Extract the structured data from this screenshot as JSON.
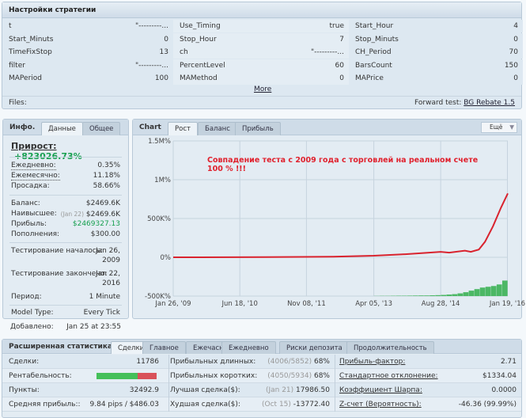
{
  "settings": {
    "title": "Настройки стратегии",
    "params": [
      [
        "t",
        "\"---------...",
        "Use_Timing",
        "true",
        "Start_Hour",
        "4"
      ],
      [
        "Start_Minuts",
        "0",
        "Stop_Hour",
        "7",
        "Stop_Minuts",
        "0"
      ],
      [
        "TimeFixStop",
        "13",
        "ch",
        "\"---------...",
        "CH_Period",
        "70"
      ],
      [
        "filter",
        "\"---------...",
        "PercentLevel",
        "60",
        "BarsCount",
        "150"
      ],
      [
        "MAPeriod",
        "100",
        "MAMethod",
        "0",
        "MAPrice",
        "0"
      ]
    ],
    "more": "More",
    "files": "Files:",
    "forward_label": "Forward test:",
    "forward_link": "BG Rebate 1.5"
  },
  "info": {
    "title": "Инфо.",
    "tabs": [
      "Данные",
      "Общее"
    ],
    "gain_label": "Прирост:",
    "gain": "+823026.73%",
    "rows1": [
      [
        "Ежедневно:",
        "0.35%"
      ],
      [
        "Ежемесячно:",
        "11.18%"
      ],
      [
        "Просадка:",
        "58.66%"
      ]
    ],
    "balance": [
      "Баланс:",
      "$2469.6K"
    ],
    "highest": [
      "Наивысшее:",
      "(Jan 22)",
      "$2469.6K"
    ],
    "profit": [
      "Прибыль:",
      "$2469327.13"
    ],
    "deposits": [
      "Пополнения:",
      "$300.00"
    ],
    "test_start": [
      "Тестирование началось:",
      "Jan 26,",
      "2009"
    ],
    "test_end": [
      "Тестирование закончено:",
      "Jan 22,",
      "2016"
    ],
    "period": [
      "Период:",
      "1 Minute"
    ],
    "model": [
      "Model Type:",
      "Every Tick"
    ],
    "added": [
      "Добавлено:",
      "Jan 25 at 23:55"
    ]
  },
  "chart_header": {
    "title": "Chart",
    "tabs": [
      "Рост",
      "Баланс",
      "Прибыль"
    ],
    "more": "Ещё"
  },
  "chart_data": {
    "type": "line",
    "annotation_line1": "Совпадение теста с 2009 года с торговлей на реальном счете",
    "annotation_line2": "100 % !!!",
    "y_ticks": [
      "1.5M%",
      "1M%",
      "500K%",
      "0%",
      "-500K%"
    ],
    "y_tick_values": [
      1500000,
      1000000,
      500000,
      0,
      -500000
    ],
    "ylim": [
      -500000,
      1500000
    ],
    "x_ticks": [
      "Jan 26, '09",
      "Jun 18, '10",
      "Nov 08, '11",
      "Apr 05, '13",
      "Aug 28, '14",
      "Jan 19, '16"
    ],
    "x_tick_dates": [
      "2009-01-26",
      "2010-06-18",
      "2011-11-08",
      "2013-04-05",
      "2014-08-28",
      "2016-01-19"
    ],
    "xlim": [
      "2009-01-26",
      "2016-01-22"
    ],
    "grid": true,
    "series": [
      {
        "color": "#d9232e",
        "points": [
          [
            "2009-01-26",
            0
          ],
          [
            "2011-01-01",
            2000
          ],
          [
            "2012-06-01",
            8000
          ],
          [
            "2013-04-05",
            20000
          ],
          [
            "2013-12-01",
            40000
          ],
          [
            "2014-06-01",
            60000
          ],
          [
            "2014-08-28",
            70000
          ],
          [
            "2014-11-01",
            60000
          ],
          [
            "2015-03-01",
            85000
          ],
          [
            "2015-04-15",
            70000
          ],
          [
            "2015-06-15",
            100000
          ],
          [
            "2015-08-01",
            200000
          ],
          [
            "2015-10-01",
            400000
          ],
          [
            "2015-12-01",
            640000
          ],
          [
            "2016-01-22",
            823000
          ]
        ]
      }
    ],
    "bars": {
      "color": "#4cb865",
      "start": "2013-04-05",
      "values_above_min": [
        2000,
        3000,
        3000,
        4000,
        5000,
        5000,
        6000,
        7000,
        8000,
        8000,
        10000,
        12000,
        15000,
        20000,
        25000,
        35000,
        50000,
        70000,
        90000,
        110000,
        120000,
        130000,
        150000,
        200000
      ]
    }
  },
  "stats": {
    "title": "Расширенная статистика",
    "tabs": [
      "Сделки",
      "Главное",
      "Ежечасно",
      "Ежедневно",
      "Риски депозита",
      "Продолжительность"
    ],
    "col1": [
      [
        "Сделки:",
        "11786"
      ],
      [
        "Рентабельность:",
        ""
      ],
      [
        "Пункты:",
        "32492.9"
      ],
      [
        "Средняя прибыль::",
        "9.84 pips / $486.03"
      ]
    ],
    "profitability_win_fraction": 0.68,
    "col2": [
      [
        "Прибыльных длинных:",
        "(4006/5852)",
        "68%"
      ],
      [
        "Прибыльных коротких:",
        "(4050/5934)",
        "68%"
      ],
      [
        "Лучшая сделка($):",
        "(Jan 21)",
        "17986.50"
      ],
      [
        "Худшая сделка($):",
        "(Oct 15)",
        "-13772.40"
      ]
    ],
    "col3": [
      [
        "Прибыль-фактор:",
        "2.71"
      ],
      [
        "Стандартное отклонение:",
        "$1334.04"
      ],
      [
        "Коэффициент Шарпа:",
        "0.0000"
      ],
      [
        "Z-счет (Вероятность):",
        "-46.36 (99.99%)"
      ]
    ]
  }
}
